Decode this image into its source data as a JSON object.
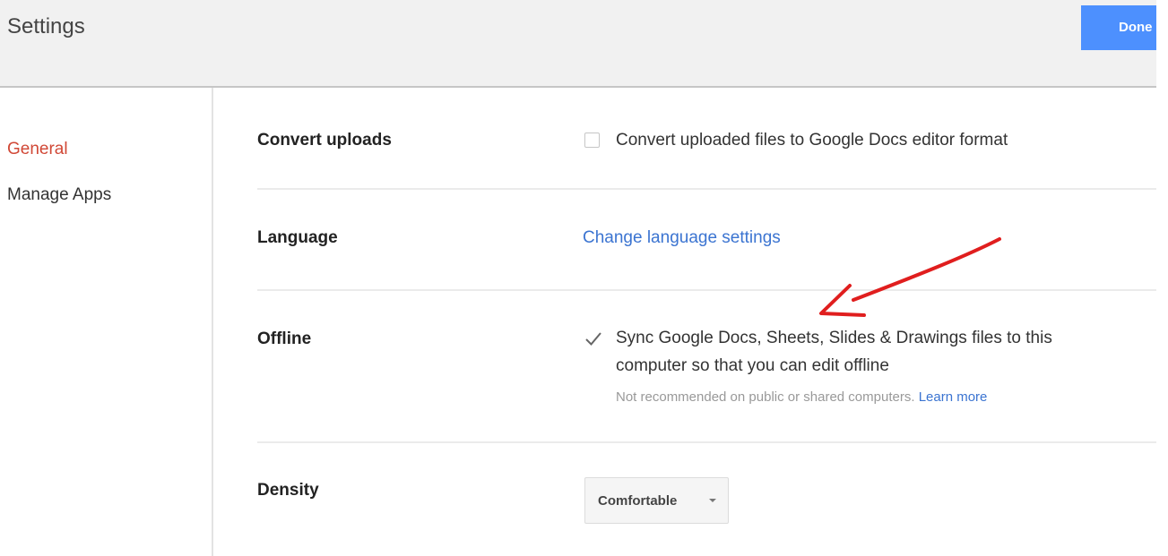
{
  "header": {
    "title": "Settings",
    "done_label": "Done"
  },
  "sidebar": {
    "items": [
      {
        "label": "General",
        "selected": true
      },
      {
        "label": "Manage Apps",
        "selected": false
      }
    ]
  },
  "settings": {
    "convert_uploads": {
      "label": "Convert uploads",
      "checkbox_label": "Convert uploaded files to Google Docs editor format",
      "checked": false
    },
    "language": {
      "label": "Language",
      "link_text": "Change language settings"
    },
    "offline": {
      "label": "Offline",
      "checkbox_line1": "Sync Google Docs, Sheets, Slides & Drawings files to this",
      "checkbox_line2": "computer so that you can edit offline",
      "checked": true,
      "note": "Not recommended on public or shared computers.",
      "learn_more": "Learn more"
    },
    "density": {
      "label": "Density",
      "selected": "Comfortable"
    }
  },
  "colors": {
    "accent_blue": "#4d90fe",
    "selected_red": "#d14836",
    "link_blue": "#3b74d1",
    "annotation_red": "#e01e1e"
  },
  "icons": {
    "checkbox": "checkbox-icon",
    "checkmark": "checkmark-icon",
    "dropdown": "caret-down-icon",
    "annotation": "red-arrow-annotation"
  }
}
